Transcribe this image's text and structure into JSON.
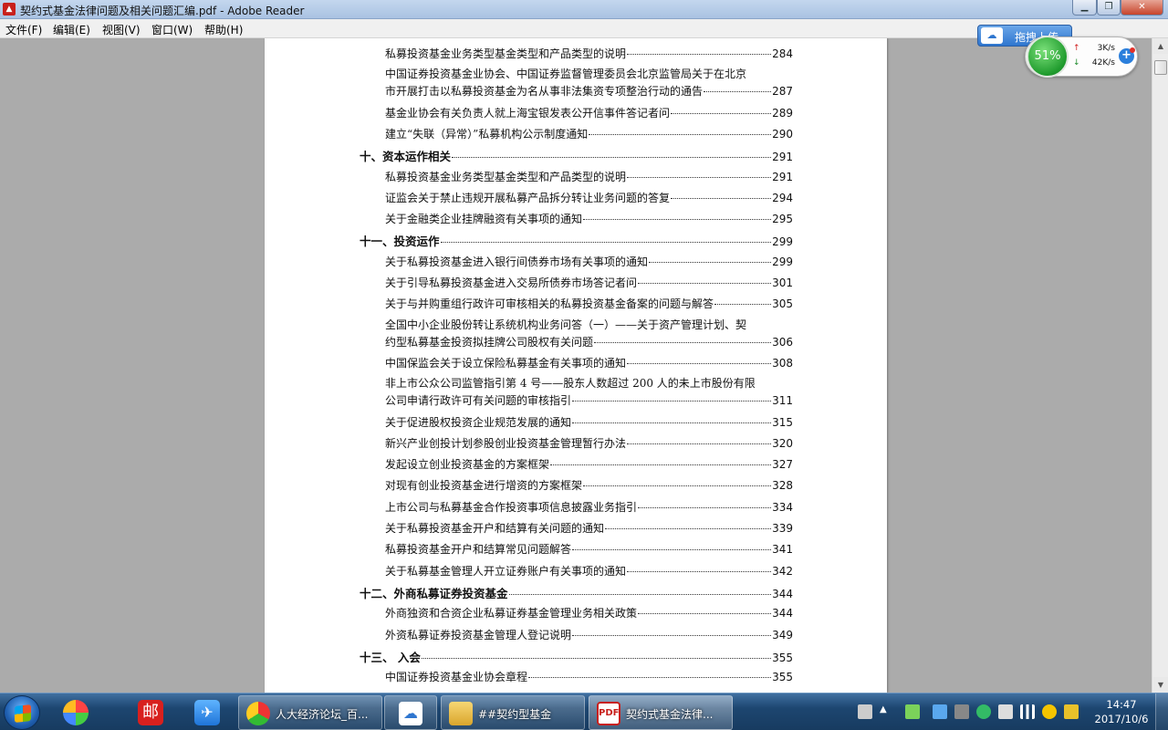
{
  "window": {
    "title": "契约式基金法律问题及相关问题汇编.pdf - Adobe Reader",
    "app_icon": "pdf-icon"
  },
  "menu": [
    "文件(F)",
    "编辑(E)",
    "视图(V)",
    "窗口(W)",
    "帮助(H)"
  ],
  "toc": [
    {
      "type": "item",
      "text": "私募投资基金业务类型基金类型和产品类型的说明",
      "page": "284"
    },
    {
      "type": "item2",
      "line1": "中国证券投资基金业协会、中国证券监督管理委员会北京监管局关于在北京",
      "text": "市开展打击以私募投资基金为名从事非法集资专项整治行动的通告",
      "page": "287"
    },
    {
      "type": "item",
      "text": "基金业协会有关负责人就上海宝银发表公开信事件答记者问",
      "page": "289"
    },
    {
      "type": "item",
      "text": "建立“失联（异常）”私募机构公示制度通知",
      "page": "290"
    },
    {
      "type": "section",
      "text": "十、资本运作相关",
      "page": "291"
    },
    {
      "type": "item",
      "text": "私募投资基金业务类型基金类型和产品类型的说明",
      "page": "291"
    },
    {
      "type": "item",
      "text": "证监会关于禁止违规开展私募产品拆分转让业务问题的答复",
      "page": "294"
    },
    {
      "type": "item",
      "text": "关于金融类企业挂牌融资有关事项的通知",
      "page": "295"
    },
    {
      "type": "section",
      "text": "十一、投资运作",
      "page": "299"
    },
    {
      "type": "item",
      "text": "关于私募投资基金进入银行间债券市场有关事项的通知",
      "page": "299"
    },
    {
      "type": "item",
      "text": "关于引导私募投资基金进入交易所债券市场答记者问",
      "page": "301"
    },
    {
      "type": "item",
      "text": "关于与并购重组行政许可审核相关的私募投资基金备案的问题与解答",
      "page": "305"
    },
    {
      "type": "item2",
      "line1": "全国中小企业股份转让系统机构业务问答（一）——关于资产管理计划、契",
      "text": "约型私募基金投资拟挂牌公司股权有关问题",
      "page": "306"
    },
    {
      "type": "item",
      "text": "中国保监会关于设立保险私募基金有关事项的通知",
      "page": "308"
    },
    {
      "type": "item2",
      "line1": "非上市公众公司监管指引第 4 号——股东人数超过 200 人的未上市股份有限",
      "text": "公司申请行政许可有关问题的审核指引",
      "page": "311"
    },
    {
      "type": "item",
      "text": "关于促进股权投资企业规范发展的通知",
      "page": "315"
    },
    {
      "type": "item",
      "text": "新兴产业创投计划参股创业投资基金管理暂行办法",
      "page": "320"
    },
    {
      "type": "item",
      "text": "发起设立创业投资基金的方案框架",
      "page": "327"
    },
    {
      "type": "item",
      "text": "对现有创业投资基金进行增资的方案框架",
      "page": "328"
    },
    {
      "type": "item",
      "text": "上市公司与私募基金合作投资事项信息披露业务指引",
      "page": "334"
    },
    {
      "type": "item",
      "text": "关于私募投资基金开户和结算有关问题的通知",
      "page": "339"
    },
    {
      "type": "item",
      "text": "私募投资基金开户和结算常见问题解答",
      "page": "341"
    },
    {
      "type": "item",
      "text": "关于私募基金管理人开立证券账户有关事项的通知",
      "page": "342"
    },
    {
      "type": "section",
      "text": "十二、外商私募证券投资基金",
      "page": "344"
    },
    {
      "type": "item",
      "text": "外商独资和合资企业私募证券基金管理业务相关政策",
      "page": "344"
    },
    {
      "type": "item",
      "text": "外资私募证券投资基金管理人登记说明",
      "page": "349"
    },
    {
      "type": "section",
      "text": "十三、  入会",
      "page": "355"
    },
    {
      "type": "item",
      "text": "中国证券投资基金业协会章程",
      "page": "355"
    }
  ],
  "float_widget": {
    "baidu_label": "拖拽上传",
    "percent": "51%",
    "upload": "3K/s",
    "download": "42K/s",
    "percent_value": 51
  },
  "taskbar": {
    "tasks": [
      {
        "label": "人大经济论坛_百...",
        "icon": "chrome-icon"
      },
      {
        "label": "",
        "icon": "baidu-netdisk-icon"
      },
      {
        "label": "##契约型基金",
        "icon": "folder-icon"
      },
      {
        "label": "契约式基金法律...",
        "icon": "adobe-reader-icon"
      }
    ],
    "clock_time": "14:47",
    "clock_date": "2017/10/6"
  }
}
